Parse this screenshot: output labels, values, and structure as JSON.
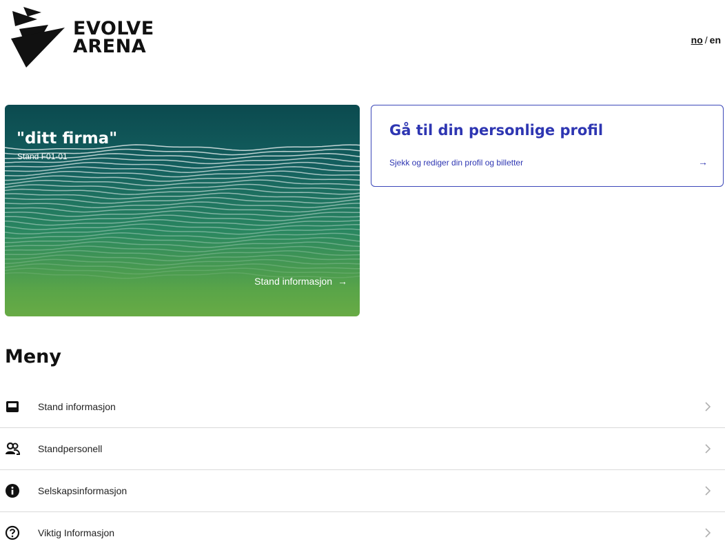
{
  "brand": {
    "name_line1": "EVOLVE",
    "name_line2": "ARENA"
  },
  "language": {
    "no": "no",
    "separator": "/",
    "en": "en",
    "active": "no"
  },
  "stand_card": {
    "title": "\"ditt firma\"",
    "subtitle": "Stand F01-01",
    "link_label": "Stand informasjon",
    "link_arrow": "→"
  },
  "profile_card": {
    "title": "Gå til din personlige profil",
    "subtitle": "Sjekk og rediger din profil og billetter",
    "arrow": "→"
  },
  "menu": {
    "title": "Meny",
    "items": [
      {
        "label": "Stand informasjon",
        "icon": "stand-icon"
      },
      {
        "label": "Standpersonell",
        "icon": "people-icon"
      },
      {
        "label": "Selskapsinformasjon",
        "icon": "info-icon"
      },
      {
        "label": "Viktig Informasjon",
        "icon": "question-icon"
      }
    ]
  },
  "colors": {
    "accent": "#2e36b2",
    "card_gradient_top": "#0b4a4f",
    "card_gradient_bottom": "#68ab45"
  }
}
